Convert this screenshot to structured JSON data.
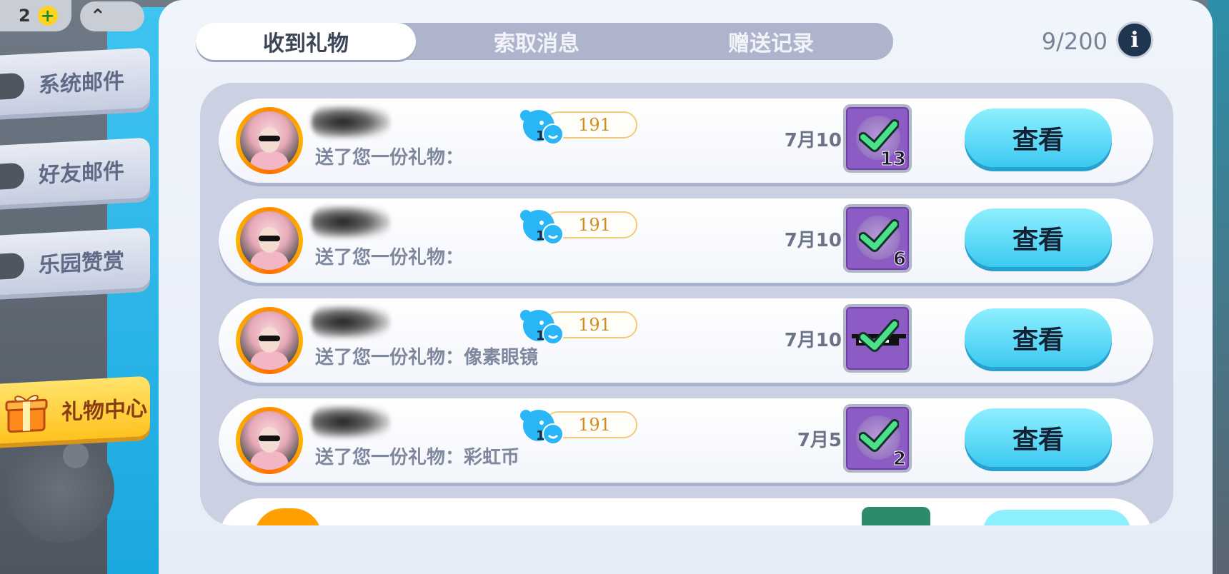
{
  "hud": {
    "coins": "2",
    "plus": "+",
    "up_label": "⌃"
  },
  "sidebar": {
    "items": [
      {
        "label": "系统邮件"
      },
      {
        "label": "好友邮件"
      },
      {
        "label": "乐园赞赏"
      },
      {
        "label": "礼物中心",
        "active": true
      }
    ]
  },
  "tabs": [
    {
      "label": "收到礼物",
      "active": true
    },
    {
      "label": "索取消息",
      "active": false
    },
    {
      "label": "赠送记录",
      "active": false
    }
  ],
  "counter": "9/200",
  "info_label": "i",
  "gifts": [
    {
      "level": "191",
      "level_badge": "1",
      "message": "送了您一份礼物：",
      "date": "7月10日",
      "count": "13",
      "item": "check",
      "button": "查看"
    },
    {
      "level": "191",
      "level_badge": "1",
      "message": "送了您一份礼物：",
      "date": "7月10日",
      "count": "6",
      "item": "check",
      "button": "查看"
    },
    {
      "level": "191",
      "level_badge": "1",
      "message": "送了您一份礼物：像素眼镜",
      "date": "7月10日",
      "count": "",
      "item": "pixel-glasses",
      "button": "查看"
    },
    {
      "level": "191",
      "level_badge": "1",
      "message": "送了您一份礼物：彩虹币",
      "date": "7月5日",
      "count": "2",
      "item": "check",
      "button": "查看"
    }
  ],
  "colors": {
    "accent_cyan": "#3cc9f1",
    "gift_purple": "#8c5bc4",
    "check_green": "#4be08a",
    "level_gold": "#d08a1e",
    "avatar_ring": "#ff8a00"
  }
}
